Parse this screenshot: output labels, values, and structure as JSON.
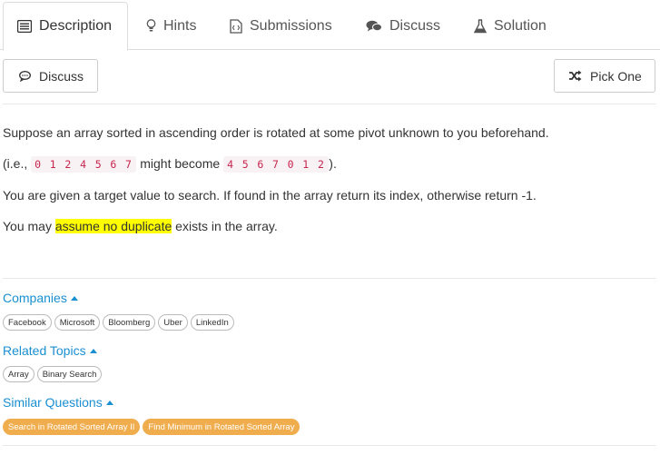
{
  "tabs": [
    {
      "label": "Description",
      "icon": "list-icon"
    },
    {
      "label": "Hints",
      "icon": "lightbulb-icon"
    },
    {
      "label": "Submissions",
      "icon": "code-file-icon"
    },
    {
      "label": "Discuss",
      "icon": "comments-icon"
    },
    {
      "label": "Solution",
      "icon": "flask-icon"
    }
  ],
  "toolbar": {
    "discuss_label": "Discuss",
    "pick_one_label": "Pick One"
  },
  "description": {
    "line1": "Suppose an array sorted in ascending order is rotated at some pivot unknown to you beforehand.",
    "line2_prefix": "(i.e., ",
    "line2_code1": "0 1 2 4 5 6 7",
    "line2_mid": " might become ",
    "line2_code2": "4 5 6 7 0 1 2",
    "line2_suffix": ").",
    "line3": "You are given a target value to search. If found in the array return its index, otherwise return -1.",
    "line4_prefix": "You may ",
    "line4_highlight": "assume no duplicate",
    "line4_suffix": " exists in the array."
  },
  "companies": {
    "title": "Companies",
    "tags": [
      "Facebook",
      "Microsoft",
      "Bloomberg",
      "Uber",
      "LinkedIn"
    ]
  },
  "related_topics": {
    "title": "Related Topics",
    "tags": [
      "Array",
      "Binary Search"
    ]
  },
  "similar_questions": {
    "title": "Similar Questions",
    "tags": [
      "Search in Rotated Sorted Array II",
      "Find Minimum in Rotated Sorted Array"
    ]
  },
  "colors": {
    "link": "#1a8fd1",
    "highlight": "#ffff00",
    "tag_orange": "#f0ad4e",
    "code_text": "#c7254e"
  }
}
